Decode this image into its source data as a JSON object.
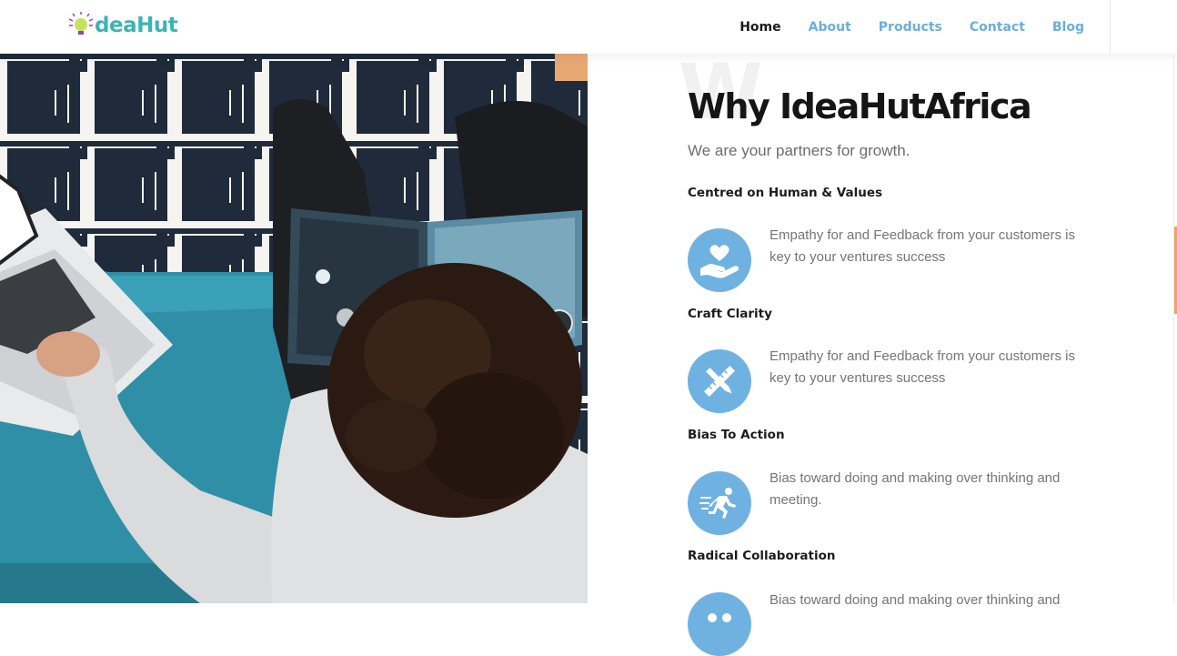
{
  "header": {
    "logo_text": "deaHut",
    "nav": [
      {
        "label": "Home",
        "active": true
      },
      {
        "label": "About",
        "active": false
      },
      {
        "label": "Products",
        "active": false
      },
      {
        "label": "Contact",
        "active": false
      },
      {
        "label": "Blog",
        "active": false
      }
    ]
  },
  "hero_image": {
    "description_icon": "person-reading-with-laptop-photo"
  },
  "section": {
    "watermark": "W",
    "title": "Why IdeaHutAfrica",
    "subtitle": "We are your partners for growth.",
    "features": [
      {
        "heading": "Centred on Human & Values",
        "icon": "heart-hand-icon",
        "text": "Empathy for and Feedback from your customers is key to your ventures success"
      },
      {
        "heading": "Craft Clarity",
        "icon": "pencil-ruler-icon",
        "text": "Empathy for and Feedback from your customers is key to your ventures success"
      },
      {
        "heading": "Bias To Action",
        "icon": "running-person-icon",
        "text": "Bias toward doing and making over thinking and meeting."
      },
      {
        "heading": "Radical Collaboration",
        "icon": "collaboration-icon",
        "text": "Bias toward doing and making over thinking and"
      }
    ]
  },
  "colors": {
    "accent_blue": "#6fb2e2",
    "nav_blue": "#6aaedc",
    "logo_teal": "#3fb3b3",
    "title": "#151515",
    "body_text": "#757575"
  }
}
